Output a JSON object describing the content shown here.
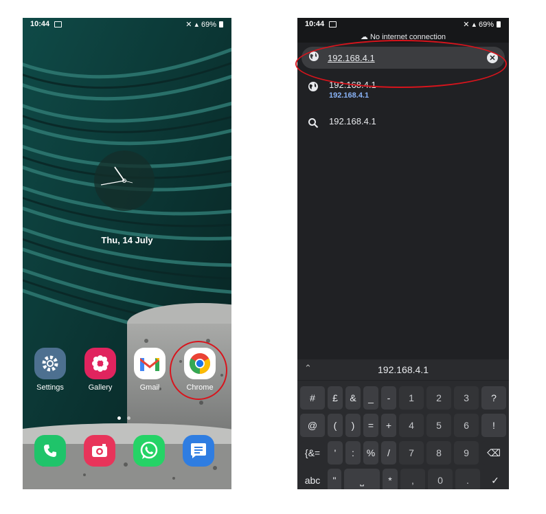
{
  "left_phone": {
    "status_bar": {
      "time": "10:44",
      "battery": "69%"
    },
    "date": "Thu, 14 July",
    "apps": [
      {
        "label": "Settings",
        "icon": "settings-gear-icon",
        "color": "#5a7d96"
      },
      {
        "label": "Gallery",
        "icon": "gallery-flower-icon",
        "color": "#e0245e"
      },
      {
        "label": "Gmail",
        "icon": "gmail-icon",
        "color": "#ffffff"
      },
      {
        "label": "Chrome",
        "icon": "chrome-icon",
        "color": "#ffffff"
      }
    ],
    "dock": [
      {
        "icon": "phone-icon",
        "color": "#1fc46a"
      },
      {
        "icon": "camera-icon",
        "color": "#e8345a"
      },
      {
        "icon": "whatsapp-icon",
        "color": "#25d366"
      },
      {
        "icon": "messages-icon",
        "color": "#2f7de1"
      }
    ],
    "highlight_color": "#d8141c"
  },
  "right_phone": {
    "status_bar": {
      "time": "10:44",
      "battery": "69%"
    },
    "banner": "No internet connection",
    "url": "192.168.4.1",
    "suggestions": [
      {
        "icon": "globe-icon",
        "title": "192.168.4.1",
        "subtitle": "192.168.4.1"
      },
      {
        "icon": "search-icon",
        "title": "192.168.4.1",
        "subtitle": ""
      }
    ],
    "keyboard_suggestion": "192.168.4.1",
    "keyboard_rows": [
      [
        "#",
        "£",
        "&",
        "_",
        "-",
        "1",
        "2",
        "3",
        "?"
      ],
      [
        "@",
        "(",
        ")",
        "=",
        "+",
        "4",
        "5",
        "6",
        "!"
      ],
      [
        "{&=",
        "'",
        ":",
        "%",
        "/",
        "7",
        "8",
        "9",
        "⌫"
      ],
      [
        "abc",
        "\"",
        "␣",
        "*",
        ",",
        "0",
        ".",
        "✓"
      ]
    ],
    "link_color": "#8ab4f8"
  }
}
